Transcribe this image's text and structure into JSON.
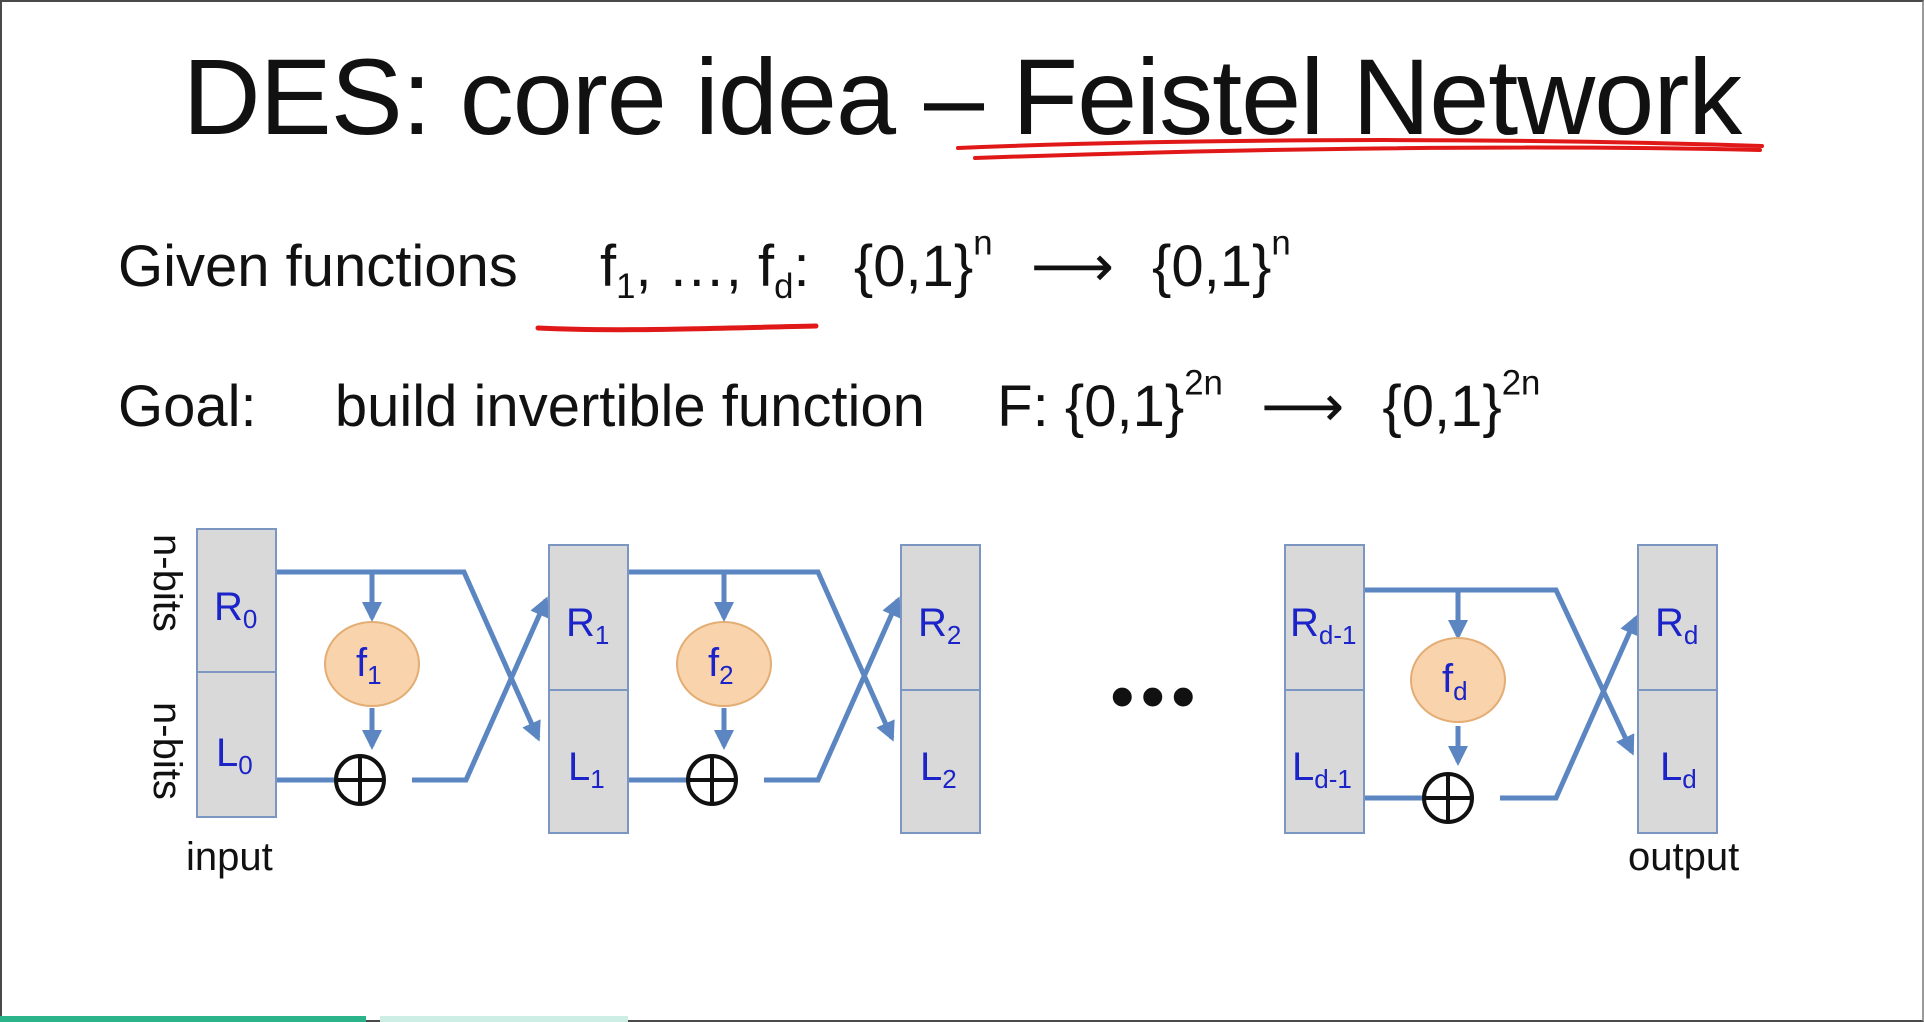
{
  "slide": {
    "title": "DES:  core idea – Feistel Network",
    "line1": {
      "prefix": "Given functions",
      "f_first": "f",
      "f_first_sub": "1",
      "ellipsis": ", …, ",
      "f_last": "f",
      "f_last_sub": "d",
      "colon": ":",
      "domain": "{0,1}",
      "domain_sup": "n",
      "arrow": "⟶",
      "codomain": "{0,1}",
      "codomain_sup": "n"
    },
    "line2": {
      "prefix": "Goal:",
      "text": "build invertible function",
      "F": "F: {0,1}",
      "F_sup": "2n",
      "arrow": "⟶",
      "codomain": "{0,1}",
      "codomain_sup": "2n"
    }
  },
  "diagram": {
    "bits_label_top": "n-bits",
    "bits_label_bottom": "n-bits",
    "input_label": "input",
    "output_label": "output",
    "dots": "•••",
    "xor_symbol": "⊕",
    "stages": [
      {
        "R": "R",
        "R_sub": "0",
        "L": "L",
        "L_sub": "0"
      },
      {
        "R": "R",
        "R_sub": "1",
        "L": "L",
        "L_sub": "1"
      },
      {
        "R": "R",
        "R_sub": "2",
        "L": "L",
        "L_sub": "2"
      },
      {
        "R": "R",
        "R_sub": "d-1",
        "L": "L",
        "L_sub": "d-1"
      },
      {
        "R": "R",
        "R_sub": "d",
        "L": "L",
        "L_sub": "d"
      }
    ],
    "functions": [
      {
        "f": "f",
        "sub": "1"
      },
      {
        "f": "f",
        "sub": "2"
      },
      {
        "f": "f",
        "sub": "d"
      }
    ]
  },
  "colors": {
    "arrow": "#5b86c1",
    "cell_fill": "#d9d9d9",
    "cell_border": "#7c96c2",
    "label": "#1a24c8",
    "function_fill": "#f8d3ac",
    "function_border": "#e3ad74",
    "annotation": "#e01818"
  }
}
